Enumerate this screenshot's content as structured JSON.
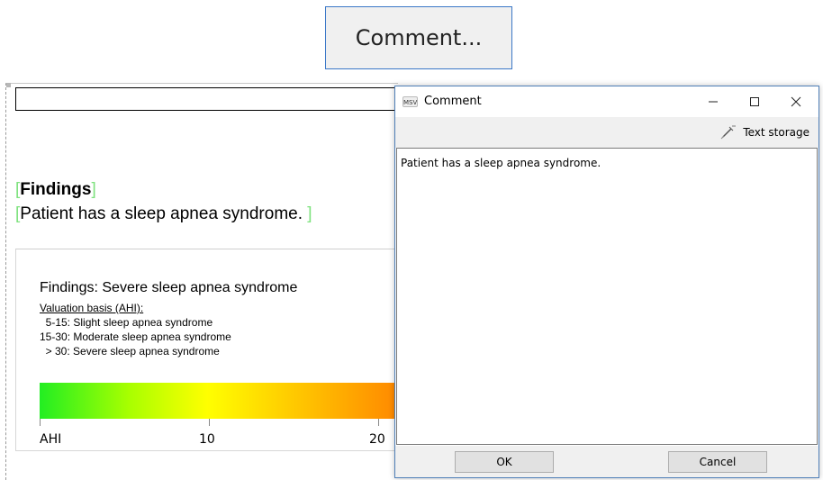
{
  "top_button": {
    "label": "Comment..."
  },
  "report": {
    "findings_title": "Findings",
    "findings_text": "Patient has a sleep apnea syndrome. ",
    "bracket_open": "[",
    "bracket_close": "]",
    "rating_title": "Findings: Severe sleep apnea syndrome",
    "basis_label": "Valuation basis (AHI):",
    "basis_lines": [
      "  5-15: Slight sleep apnea syndrome",
      "15-30: Moderate sleep apnea syndrome",
      "  > 30: Severe sleep apnea syndrome"
    ],
    "axis_labels": [
      "AHI",
      "10",
      "20"
    ]
  },
  "dialog": {
    "app_icon_text": "MSV",
    "title": "Comment",
    "minimize": "—",
    "maximize": "☐",
    "close": "✕",
    "toolbar_text_storage": "Text storage",
    "editor_text": "Patient has a sleep apnea syndrome.",
    "ok_label": "OK",
    "cancel_label": "Cancel"
  },
  "colors": {
    "dialog_border": "#4f7fb8",
    "button_border": "#3b78c7",
    "bracket": "#7ee27e",
    "gradient": [
      "#22ee22",
      "#a8ff00",
      "#ffff00",
      "#ffcc00",
      "#ff8a00"
    ]
  }
}
